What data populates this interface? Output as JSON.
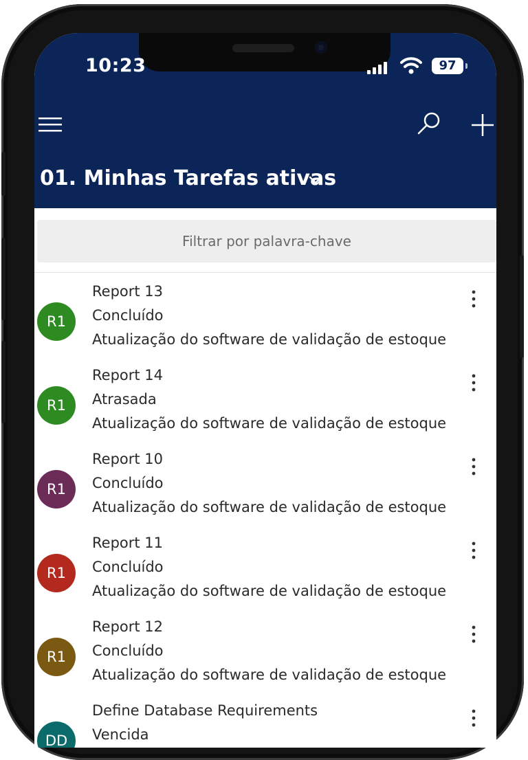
{
  "status_bar": {
    "time": "10:23",
    "battery": "97"
  },
  "toolbar": {
    "menu_icon": "hamburger-icon",
    "search_icon": "search-icon",
    "add_icon": "plus-icon"
  },
  "view": {
    "title": "01. Minhas Tarefas ativas"
  },
  "filter": {
    "placeholder": "Filtrar por palavra-chave"
  },
  "tasks": [
    {
      "avatar": "R1",
      "avatar_color": "#2e8b22",
      "title": "Report 13",
      "status": "Concluído",
      "description": "Atualização do software de validação de estoque"
    },
    {
      "avatar": "R1",
      "avatar_color": "#2e8b22",
      "title": "Report 14",
      "status": "Atrasada",
      "description": "Atualização do software de validação de estoque"
    },
    {
      "avatar": "R1",
      "avatar_color": "#6b2d58",
      "title": "Report 10",
      "status": "Concluído",
      "description": "Atualização do software de validação de estoque"
    },
    {
      "avatar": "R1",
      "avatar_color": "#b3291e",
      "title": "Report 11",
      "status": "Concluído",
      "description": "Atualização do software de validação de estoque"
    },
    {
      "avatar": "R1",
      "avatar_color": "#7a5a12",
      "title": "Report 12",
      "status": "Concluído",
      "description": "Atualização do software de validação de estoque"
    },
    {
      "avatar": "DD",
      "avatar_color": "#0b6b6b",
      "title": "Define Database Requirements",
      "status": "Vencida",
      "description": ""
    }
  ],
  "colors": {
    "header": "#0b2559",
    "filter_bg": "#eeeeee"
  }
}
